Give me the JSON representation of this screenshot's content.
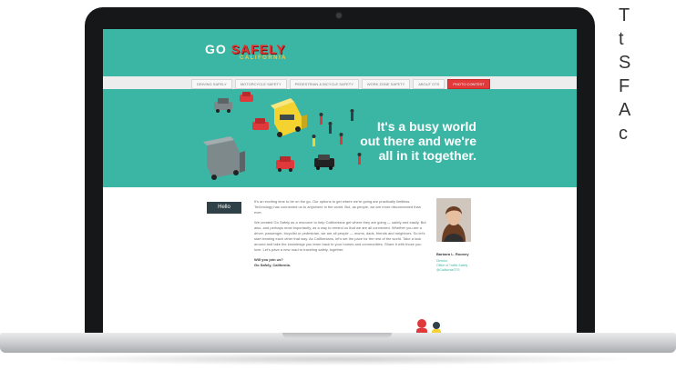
{
  "site": {
    "logo": {
      "go": "GO",
      "safely": "SAFELY",
      "sub": "CALIFORNIA"
    },
    "nav": [
      {
        "label": "DRIVING SAFELY",
        "active": false
      },
      {
        "label": "MOTORCYCLE SAFETY",
        "active": false
      },
      {
        "label": "PEDESTRIAN & BICYCLE SAFETY",
        "active": false
      },
      {
        "label": "WORK ZONE SAFETY",
        "active": false
      },
      {
        "label": "ABOUT OTS",
        "active": false
      },
      {
        "label": "PHOTO CONTEST",
        "active": true
      }
    ],
    "hero": {
      "tagline_lines": [
        "It's a busy world",
        "out there and we're",
        "all in it together."
      ]
    },
    "hello_label": "Hello",
    "body_paragraphs": [
      "It's an exciting time to be on the go. Our options to get where we're going are practically limitless. Technology has connected us to anywhere in the world. But, as people, we are more disconnected than ever.",
      "We created Go Safely as a resource to help Californians get where they are going — safely and easily. But also, and perhaps most importantly, as a way to remind us that we are all connected. Whether you are a driver, passenger, bicyclist or pedestrian, we are all people — moms, dads, friends and neighbors. So let's start treating each other that way. As Californians, let's set the pace for the rest of the world. Take a look around and take the knowledge you learn back to your homes and communities. Share it with those you love. Let's pave a new road to traveling safely, together."
    ],
    "signoff": [
      "Will you join us?",
      "Go Safely, California."
    ],
    "profile": {
      "name": "Barbara L. Rooney",
      "links": [
        "Director",
        "Office of Traffic Safety",
        "@CaliforniaOTS"
      ]
    }
  },
  "side_text_lines": [
    "T",
    "t",
    "S",
    "F",
    "A",
    "c"
  ],
  "colors": {
    "teal": "#3bb6a4",
    "red": "#e23a3a",
    "dark_badge": "#2f4046",
    "bezel": "#161718"
  },
  "icons": [
    "camera-icon",
    "car-illustration",
    "person-illustration"
  ]
}
